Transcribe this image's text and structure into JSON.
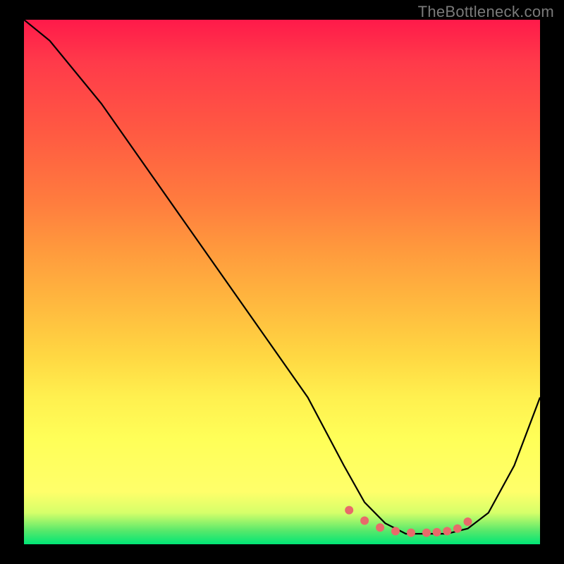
{
  "watermark": "TheBottleneck.com",
  "chart_data": {
    "type": "line",
    "title": "",
    "xlabel": "",
    "ylabel": "",
    "xlim": [
      0,
      100
    ],
    "ylim": [
      0,
      100
    ],
    "grid": false,
    "series": [
      {
        "name": "curve",
        "color": "#000000",
        "x": [
          0,
          5,
          15,
          25,
          35,
          45,
          55,
          62,
          66,
          70,
          74,
          78,
          82,
          86,
          90,
          95,
          100
        ],
        "values": [
          100,
          96,
          84,
          70,
          56,
          42,
          28,
          15,
          8,
          4,
          2,
          2,
          2,
          3,
          6,
          15,
          28
        ]
      }
    ],
    "markers": {
      "name": "highlight-zone",
      "color": "#e86a6a",
      "x": [
        63,
        66,
        69,
        72,
        75,
        78,
        80,
        82,
        84,
        86
      ],
      "values": [
        6.5,
        4.5,
        3.2,
        2.5,
        2.2,
        2.2,
        2.3,
        2.5,
        3.0,
        4.3
      ]
    },
    "gradient_stops": [
      {
        "pos": 0.0,
        "color": "#ff1a4a"
      },
      {
        "pos": 0.22,
        "color": "#ff5b42"
      },
      {
        "pos": 0.44,
        "color": "#ff9a3d"
      },
      {
        "pos": 0.64,
        "color": "#ffd742"
      },
      {
        "pos": 0.8,
        "color": "#ffff58"
      },
      {
        "pos": 0.94,
        "color": "#d6ff6a"
      },
      {
        "pos": 1.0,
        "color": "#00e676"
      }
    ]
  }
}
